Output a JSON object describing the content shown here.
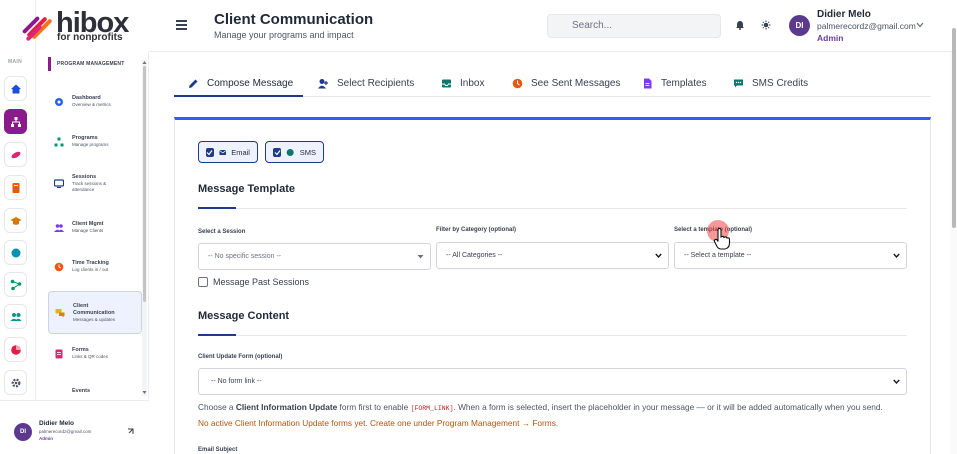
{
  "brand": {
    "name": "hibox",
    "tagline": "for nonprofits"
  },
  "rail": {
    "section_label": "MAIN",
    "items": [
      {
        "icon": "home-icon"
      },
      {
        "icon": "sitemap-icon",
        "active": true
      },
      {
        "icon": "feather-icon"
      },
      {
        "icon": "book-icon"
      },
      {
        "icon": "graduation-icon"
      },
      {
        "icon": "circle-icon"
      },
      {
        "icon": "flow-icon"
      },
      {
        "icon": "users-icon"
      },
      {
        "icon": "pie-icon"
      },
      {
        "icon": "gear-icon"
      }
    ]
  },
  "sidebar": {
    "section_label": "PROGRAM MANAGEMENT",
    "items": [
      {
        "title": "Dashboard",
        "subtitle": "Overview & metrics"
      },
      {
        "title": "Programs",
        "subtitle": "Manage programs"
      },
      {
        "title": "Sessions",
        "subtitle": "Track sessions & attendance"
      },
      {
        "title": "Client Mgmt",
        "subtitle": "Manage Clients"
      },
      {
        "title": "Time Tracking",
        "subtitle": "Log clients in / out"
      },
      {
        "title": "Client Communication",
        "subtitle": "Messages & updates"
      },
      {
        "title": "Forms",
        "subtitle": "Links & QR codes"
      },
      {
        "title": "Events",
        "subtitle": ""
      }
    ],
    "user": {
      "initials": "DI",
      "name": "Didier Melo",
      "email": "palmerecordz@gmail.com",
      "role": "Admin"
    }
  },
  "header": {
    "title": "Client Communication",
    "subtitle": "Manage your programs and impact",
    "search_placeholder": "Search...",
    "user": {
      "initials": "DI",
      "name": "Didier Melo",
      "email": "palmerecordz@gmail.com",
      "role": "Admin"
    }
  },
  "tabs": [
    {
      "label": "Compose Message",
      "icon": "pencil-icon",
      "active": true
    },
    {
      "label": "Select Recipients",
      "icon": "user-plus-icon"
    },
    {
      "label": "Inbox",
      "icon": "inbox-icon"
    },
    {
      "label": "See Sent Messages",
      "icon": "history-icon"
    },
    {
      "label": "Templates",
      "icon": "file-icon"
    },
    {
      "label": "SMS Credits",
      "icon": "chat-icon"
    }
  ],
  "channels": [
    {
      "label": "Email",
      "checked": true
    },
    {
      "label": "SMS",
      "checked": true
    }
  ],
  "template_section": {
    "title": "Message Template",
    "session_label": "Select a Session",
    "session_value": "-- No specific session --",
    "category_label": "Filter by Category (optional)",
    "category_value": "-- All Categories --",
    "template_label": "Select a template (optional)",
    "template_value": "-- Select a template --",
    "past_sessions_label": "Message Past Sessions"
  },
  "content_section": {
    "title": "Message Content",
    "form_label": "Client Update Form (optional)",
    "form_value": "-- No form link --",
    "help_pre": "Choose a ",
    "help_bold": "Client Information Update",
    "help_mid": " form first to enable ",
    "help_code": "[FORM_LINK]",
    "help_post": ". When a form is selected, insert the placeholder in your message — or it will be added automatically when you send.",
    "warning": "No active Client Information Update forms yet. Create one under Program Management → Forms.",
    "email_subject_label": "Email Subject"
  }
}
